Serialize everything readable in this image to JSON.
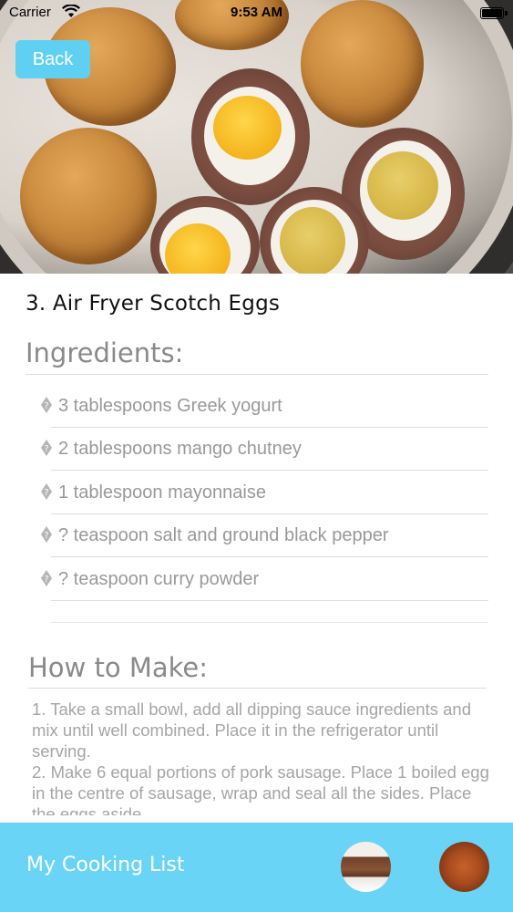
{
  "status_bar": {
    "carrier": "Carrier",
    "time": "9:53 AM",
    "wifi_icon": "wifi-icon",
    "battery_icon": "battery-full-icon"
  },
  "hero": {
    "image": "scotch-eggs-photo"
  },
  "nav": {
    "back_label": "Back"
  },
  "recipe": {
    "title": "3. Air Fryer Scotch Eggs",
    "ingredients_heading": "Ingredients:",
    "ingredients": [
      "3 tablespoons Greek yogurt",
      "2 tablespoons mango chutney",
      "1 tablespoon mayonnaise",
      "? teaspoon salt and ground black pepper",
      "? teaspoon curry powder"
    ],
    "bullet_icon": "replacement-char-icon",
    "howto_heading": "How to Make:",
    "howto_text": "1. Take a small bowl, add all dipping sauce ingredients and mix until well combined. Place it in the refrigerator until serving.\n2. Make 6 equal portions of pork sausage. Place 1 boiled egg in the centre of sausage, wrap and seal all the sides. Place the eggs aside."
  },
  "tab_bar": {
    "title": "My Cooking List",
    "thumbnails": [
      "meatloaf-thumbnail",
      "roast-thumbnail"
    ]
  },
  "colors": {
    "accent": "#6ad4f6",
    "back_button": "#5fd0f2",
    "heading_text": "#8a8a8a",
    "body_text": "#999999"
  }
}
